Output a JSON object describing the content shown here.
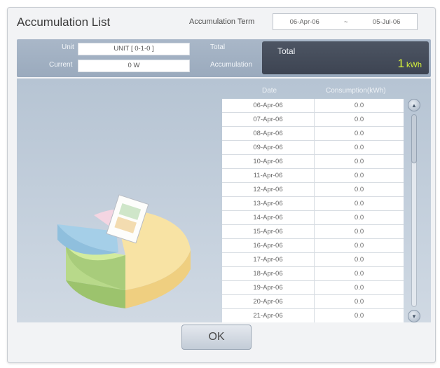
{
  "window": {
    "title": "Accumulation List"
  },
  "term": {
    "label": "Accumulation Term",
    "start": "06-Apr-06",
    "separator": "~",
    "end": "05-Jul-06"
  },
  "info": {
    "unit_label": "Unit",
    "unit_value": "UNIT [ 0-1-0 ]",
    "current_label": "Current",
    "current_value": "0 W",
    "total_label_line1": "Total",
    "total_label_line2": "Accumulation",
    "total_box_label": "Total",
    "total_value": "1",
    "total_unit": "kWh"
  },
  "table": {
    "headers": [
      "Date",
      "Consumption(kWh)"
    ],
    "rows": [
      [
        "06-Apr-06",
        "0.0"
      ],
      [
        "07-Apr-06",
        "0.0"
      ],
      [
        "08-Apr-06",
        "0.0"
      ],
      [
        "09-Apr-06",
        "0.0"
      ],
      [
        "10-Apr-06",
        "0.0"
      ],
      [
        "11-Apr-06",
        "0.0"
      ],
      [
        "12-Apr-06",
        "0.0"
      ],
      [
        "13-Apr-06",
        "0.0"
      ],
      [
        "14-Apr-06",
        "0.0"
      ],
      [
        "15-Apr-06",
        "0.0"
      ],
      [
        "16-Apr-06",
        "0.0"
      ],
      [
        "17-Apr-06",
        "0.0"
      ],
      [
        "18-Apr-06",
        "0.0"
      ],
      [
        "19-Apr-06",
        "0.0"
      ],
      [
        "20-Apr-06",
        "0.0"
      ],
      [
        "21-Apr-06",
        "0.0"
      ]
    ]
  },
  "footer": {
    "ok_label": "OK"
  },
  "colors": {
    "total_value": "#d7f23a",
    "band": "#a9b7c8",
    "total_box": "#434b59"
  },
  "icons": [
    "chevron-up-icon",
    "chevron-down-icon",
    "pie-chart-illustration"
  ]
}
